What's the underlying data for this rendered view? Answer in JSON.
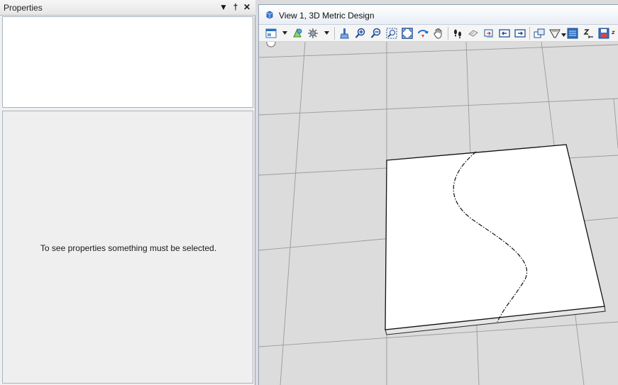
{
  "properties_panel": {
    "title": "Properties",
    "pin_glyph": "†",
    "close_glyph": "✕",
    "menu_glyph": "▼",
    "empty_message": "To see properties something must be selected."
  },
  "view_window": {
    "title": "View 1, 3D Metric Design",
    "accent": "#2f6fbf"
  },
  "toolbar": {
    "buttons": [
      "view-attributes-icon",
      "display-style-icon",
      "lighting-icon",
      "update-view-icon",
      "zoom-in-icon",
      "zoom-out-icon",
      "window-area-icon",
      "fit-view-icon",
      "rotate-view-icon",
      "pan-view-icon",
      "walk-icon",
      "view-previous-icon",
      "view-next-icon",
      "copy-view-icon",
      "arrow-left-icon",
      "arrow-right-icon",
      "clip-volume-icon",
      "camera-icon",
      "render-icon",
      "ruler-icon",
      "save-icon",
      "more-icon"
    ]
  }
}
